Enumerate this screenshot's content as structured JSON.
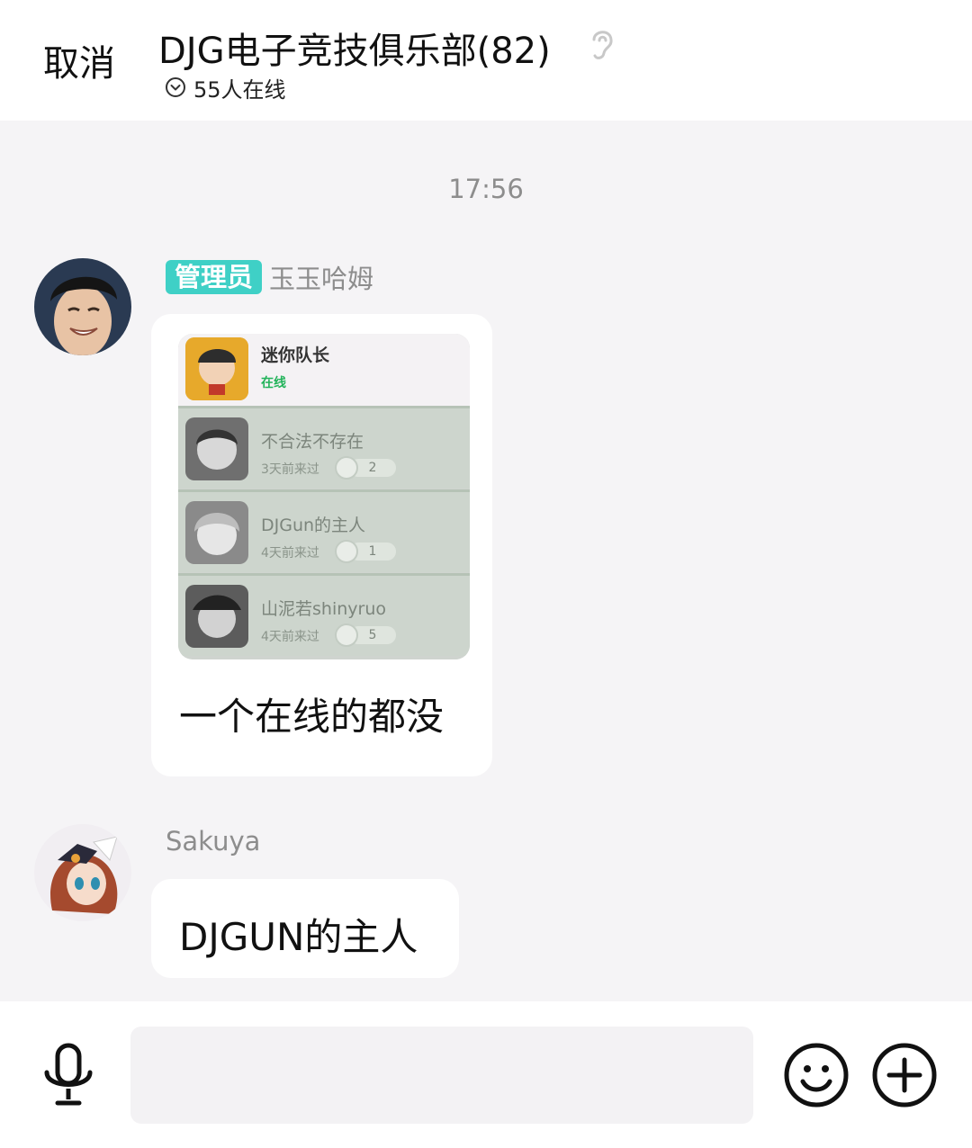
{
  "header": {
    "cancel_label": "取消",
    "title": "DJG电子竞技俱乐部(82)",
    "online_text": "55人在线"
  },
  "chat": {
    "timestamp": "17:56",
    "messages": [
      {
        "badge": "管理员",
        "sender": "玉玉哈姆",
        "text": "一个在线的都没",
        "image": {
          "top": {
            "name": "迷你队长",
            "status": "在线"
          },
          "rows": [
            {
              "name": "不合法不存在",
              "sub": "3天前来过",
              "count": "2"
            },
            {
              "name": "DJGun的主人",
              "sub": "4天前来过",
              "count": "1"
            },
            {
              "name": "山泥若shinyruo",
              "sub": "4天前来过",
              "count": "5"
            }
          ]
        }
      },
      {
        "sender": "Sakuya",
        "text": "DJGUN的主人"
      }
    ]
  },
  "inputbar": {
    "icons": [
      "microphone-icon",
      "emoji-icon",
      "plus-icon"
    ]
  },
  "colors": {
    "badge": "#3fd0c6",
    "background": "#f5f4f6",
    "online_green": "#22b35a"
  }
}
